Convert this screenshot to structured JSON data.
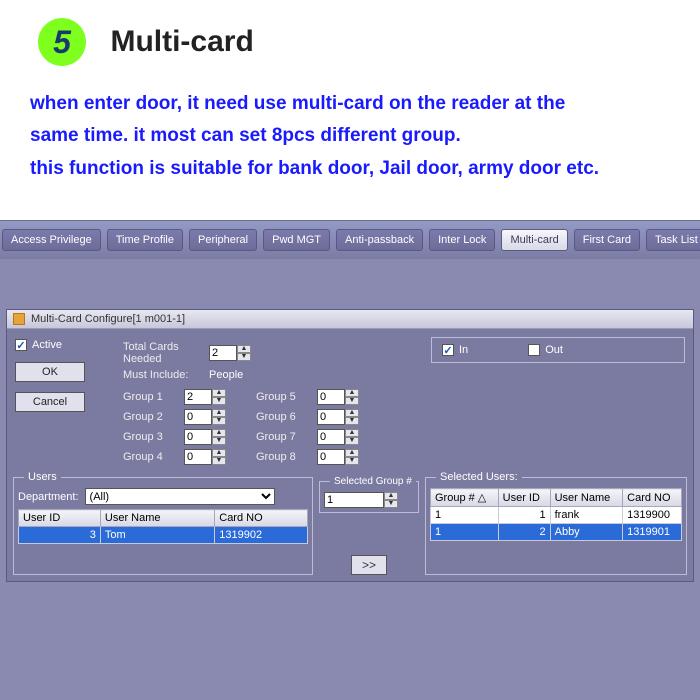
{
  "header": {
    "badge": "5",
    "title": "Multi-card",
    "desc_line1": "when enter door, it need use multi-card on the reader at the",
    "desc_line2": "same time.  it most can set 8pcs different group.",
    "desc_line3": "this function is suitable for bank door, Jail door, army door etc."
  },
  "tabs": [
    "Access Privilege",
    "Time Profile",
    "Peripheral",
    "Pwd MGT",
    "Anti-passback",
    "Inter Lock",
    "Multi-card",
    "First Card",
    "Task List"
  ],
  "active_tab": "Multi-card",
  "window": {
    "title": "Multi-Card Configure[1   m001-1]",
    "active_label": "Active",
    "ok": "OK",
    "cancel": "Cancel",
    "total_cards_label": "Total Cards Needed",
    "total_cards_value": "2",
    "must_include_label": "Must Include:",
    "people_label": "People",
    "groups_left": [
      {
        "label": "Group 1",
        "value": "2"
      },
      {
        "label": "Group 2",
        "value": "0"
      },
      {
        "label": "Group 3",
        "value": "0"
      },
      {
        "label": "Group 4",
        "value": "0"
      }
    ],
    "groups_right": [
      {
        "label": "Group 5",
        "value": "0"
      },
      {
        "label": "Group 6",
        "value": "0"
      },
      {
        "label": "Group 7",
        "value": "0"
      },
      {
        "label": "Group 8",
        "value": "0"
      }
    ],
    "in_label": "In",
    "out_label": "Out"
  },
  "users": {
    "legend": "Users",
    "dept_label": "Department:",
    "dept_value": "(All)",
    "cols": [
      "User ID",
      "User Name",
      "Card NO"
    ],
    "rows": [
      {
        "id": "3",
        "name": "Tom",
        "card": "1319902"
      }
    ]
  },
  "selgroup": {
    "label": "Selected Group #",
    "value": "1"
  },
  "selected": {
    "legend": "Selected Users:",
    "cols": [
      "Group #  △",
      "User ID",
      "User Name",
      "Card NO"
    ],
    "rows": [
      {
        "g": "1",
        "id": "1",
        "name": "frank",
        "card": "1319900"
      },
      {
        "g": "1",
        "id": "2",
        "name": "Abby",
        "card": "1319901"
      }
    ]
  },
  "arrow": ">>"
}
